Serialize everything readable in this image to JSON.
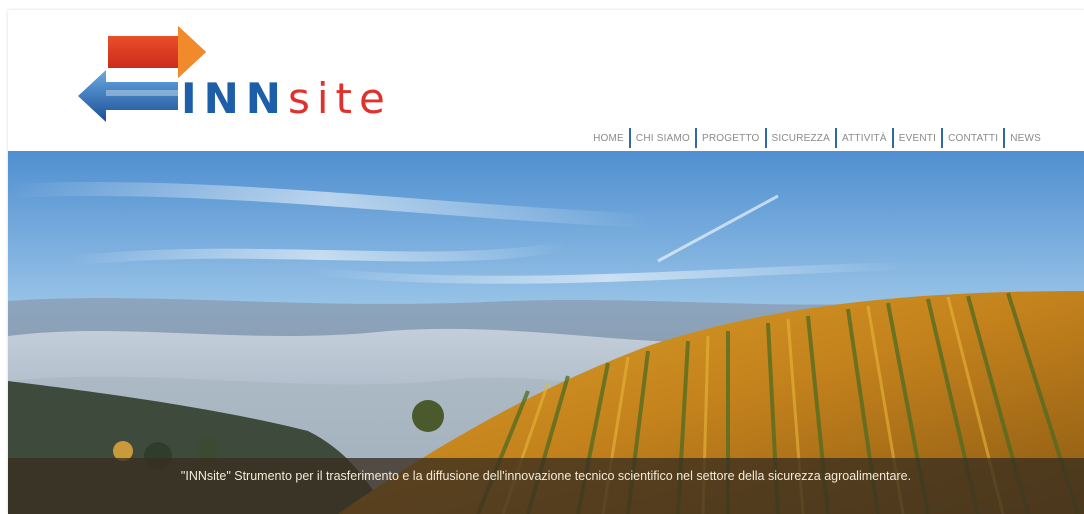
{
  "brand": {
    "part1": "INN",
    "part2": "site"
  },
  "nav": {
    "items": [
      {
        "label": "HOME"
      },
      {
        "label": "CHI SIAMO"
      },
      {
        "label": "PROGETTO"
      },
      {
        "label": "SICUREZZA"
      },
      {
        "label": "ATTIVITÀ"
      },
      {
        "label": "EVENTI"
      },
      {
        "label": "CONTATTI"
      },
      {
        "label": "NEWS"
      }
    ]
  },
  "hero": {
    "caption": "\"INNsite\" Strumento per il trasferimento e la diffusione dell'innovazione tecnico scientifico nel settore della sicurezza agroalimentare."
  },
  "colors": {
    "brand_blue": "#1c5fa8",
    "brand_red": "#e0312d",
    "nav_separator": "#2d69ad"
  }
}
